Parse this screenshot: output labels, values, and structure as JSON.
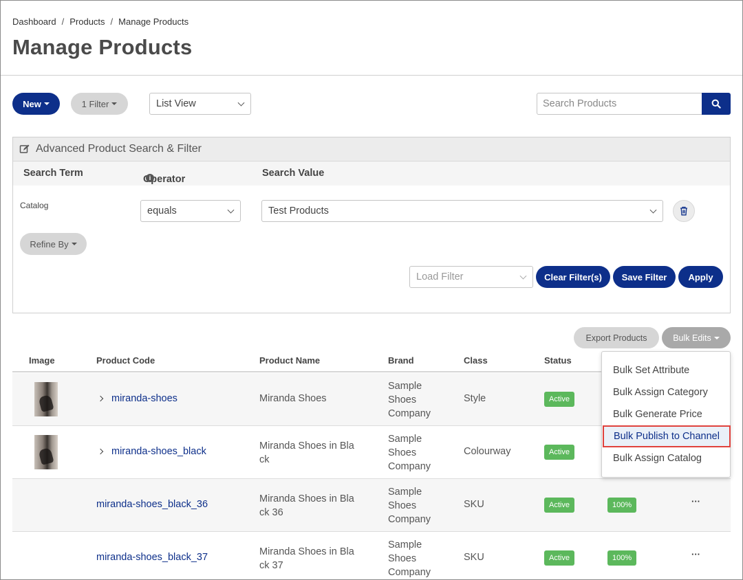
{
  "breadcrumb": {
    "items": [
      "Dashboard",
      "Products",
      "Manage Products"
    ],
    "separator": "/"
  },
  "page_title": "Manage Products",
  "toolbar": {
    "new_label": "New",
    "filter_label": "1 Filter",
    "view_select": "List View",
    "search_placeholder": "Search Products"
  },
  "advanced": {
    "title": "Advanced Product Search & Filter",
    "col_term": "Search Term",
    "col_operator": "Operator",
    "col_value": "Search Value",
    "term": "Catalog",
    "operator": "equals",
    "value": "Test Products",
    "refine_label": "Refine By",
    "load_filter_placeholder": "Load Filter",
    "clear_label": "Clear Filter(s)",
    "save_label": "Save Filter",
    "apply_label": "Apply"
  },
  "actions": {
    "export_label": "Export Products",
    "bulk_label": "Bulk Edits"
  },
  "table": {
    "headers": {
      "image": "Image",
      "code": "Product Code",
      "name": "Product Name",
      "brand": "Brand",
      "class": "Class",
      "status": "Status"
    },
    "rows": [
      {
        "code": "miranda-shoes",
        "name": [
          "Miranda Shoes"
        ],
        "brand": [
          "Sample",
          "Shoes",
          "Company"
        ],
        "class": "Style",
        "status": "Active"
      },
      {
        "code": "miranda-shoes_black",
        "name": [
          "Miranda Shoes in Bla",
          "ck"
        ],
        "brand": [
          "Sample",
          "Shoes",
          "Company"
        ],
        "class": "Colourway",
        "status": "Active"
      },
      {
        "code": "miranda-shoes_black_36",
        "name": [
          "Miranda Shoes in Bla",
          "ck 36"
        ],
        "brand": [
          "Sample",
          "Shoes",
          "Company"
        ],
        "class": "SKU",
        "status": "Active",
        "completeness": "100%",
        "more": "···"
      },
      {
        "code": "miranda-shoes_black_37",
        "name": [
          "Miranda Shoes in Bla",
          "ck 37"
        ],
        "brand": [
          "Sample",
          "Shoes",
          "Company"
        ],
        "class": "SKU",
        "status": "Active",
        "completeness": "100%",
        "more": "···"
      }
    ]
  },
  "bulk_menu": {
    "items": [
      "Bulk Set Attribute",
      "Bulk Assign Category",
      "Bulk Generate Price",
      "Bulk Publish to Channel",
      "Bulk Assign Catalog"
    ],
    "highlighted": "Bulk Publish to Channel"
  },
  "colors": {
    "primary": "#0d2f8a",
    "active_badge": "#5cb85c",
    "highlight_outline": "#e0413c"
  }
}
